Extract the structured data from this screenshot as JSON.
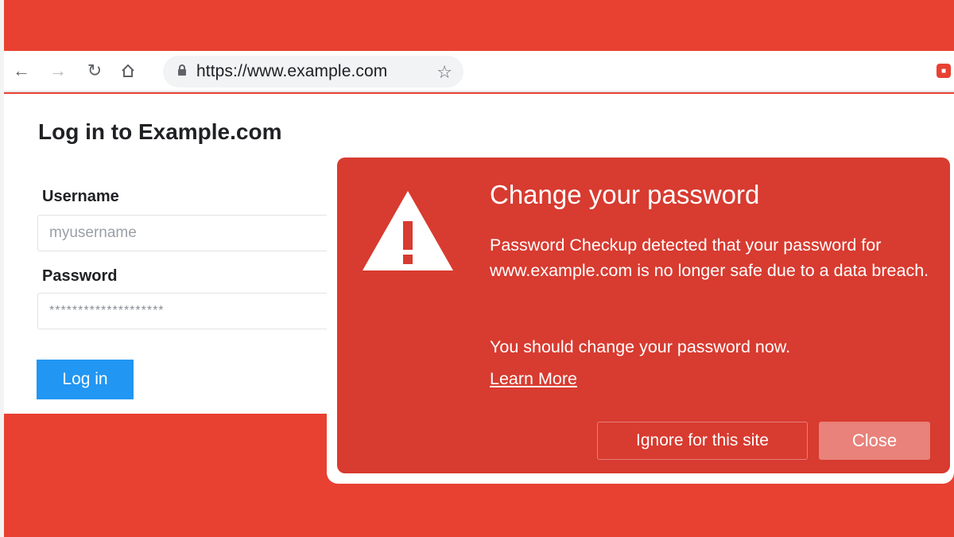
{
  "browser": {
    "url": "https://www.example.com",
    "icons": [
      "back-arrow-icon",
      "forward-arrow-icon",
      "reload-icon",
      "home-icon",
      "lock-icon",
      "star-icon",
      "extension-icon"
    ]
  },
  "login_page": {
    "title": "Log in to Example.com",
    "username_label": "Username",
    "username_placeholder": "myusername",
    "password_label": "Password",
    "password_value": "********************",
    "login_button": "Log in",
    "button_color": "#2196f3"
  },
  "dialog": {
    "title": "Change your password",
    "body": "Password Checkup detected that your password for www.example.com is no longer safe due to a data breach.",
    "advice": "You should change your password now.",
    "learn_more": "Learn More",
    "ignore_button": "Ignore for this site",
    "close_button": "Close",
    "icon": "warning-triangle-icon",
    "background_color": "#d83b30"
  },
  "colors": {
    "backdrop": "#e84132",
    "accent": "#2196f3"
  }
}
